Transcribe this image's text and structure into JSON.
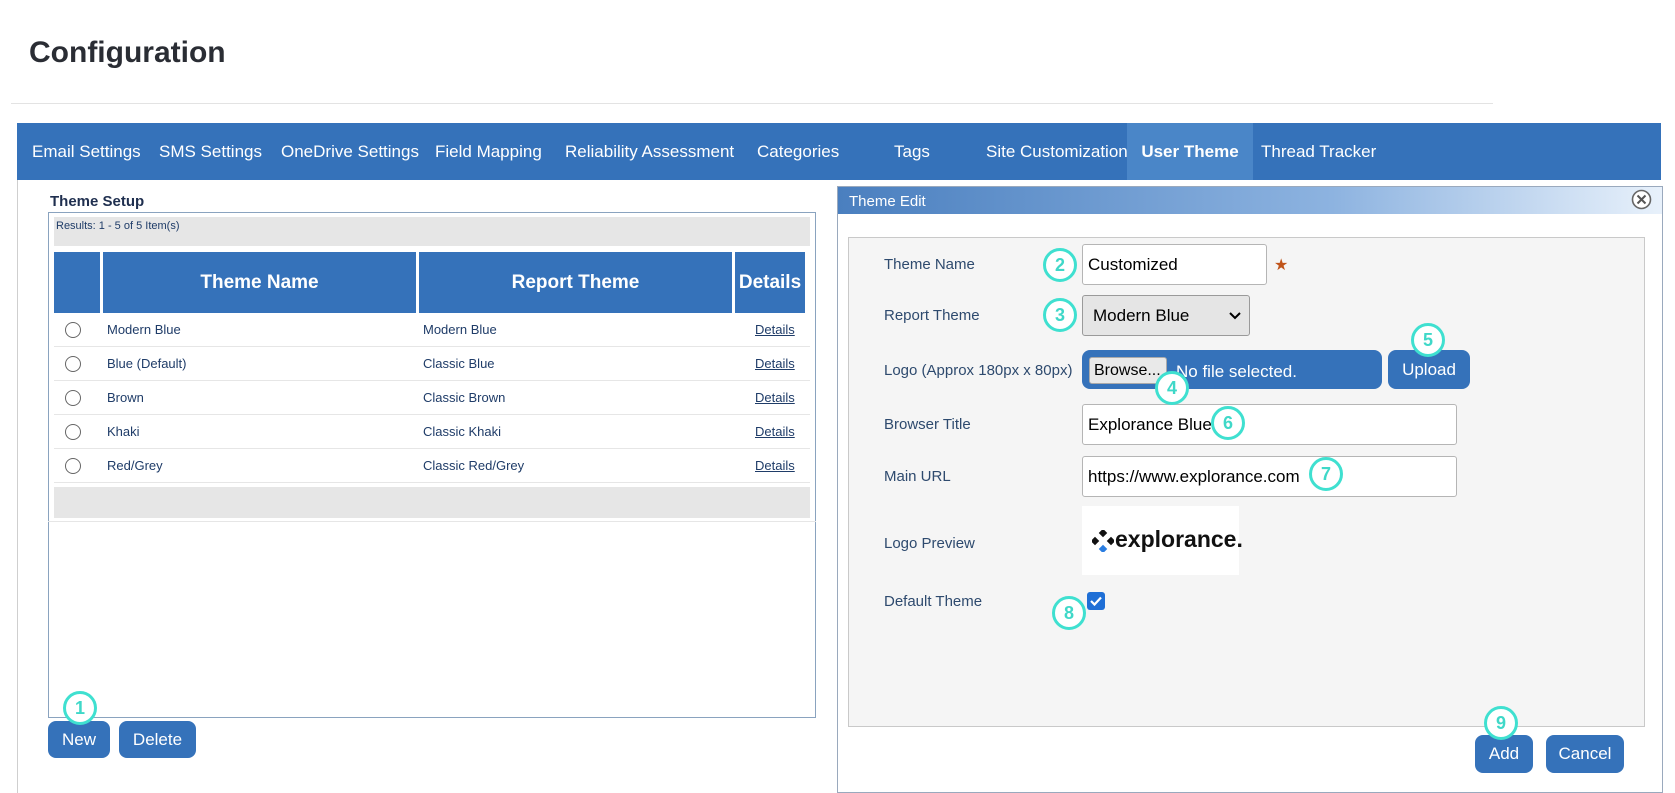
{
  "page": {
    "title": "Configuration"
  },
  "tabs": [
    {
      "label": "Email Settings",
      "active": false
    },
    {
      "label": "SMS Settings",
      "active": false
    },
    {
      "label": "OneDrive Settings",
      "active": false
    },
    {
      "label": "Field Mapping",
      "active": false
    },
    {
      "label": "Reliability Assessment",
      "active": false
    },
    {
      "label": "Categories",
      "active": false
    },
    {
      "label": "Tags",
      "active": false
    },
    {
      "label": "Site Customization",
      "active": false
    },
    {
      "label": "User Theme",
      "active": true
    },
    {
      "label": "Thread Tracker",
      "active": false
    }
  ],
  "theme_setup": {
    "title": "Theme Setup",
    "results": "Results: 1 - 5 of 5 Item(s)",
    "columns": [
      "Theme Name",
      "Report Theme",
      "Details"
    ],
    "rows": [
      {
        "name": "Modern Blue",
        "report": "Modern Blue",
        "details": "Details"
      },
      {
        "name": "Blue (Default)",
        "report": "Classic Blue",
        "details": "Details"
      },
      {
        "name": "Brown",
        "report": "Classic Brown",
        "details": "Details"
      },
      {
        "name": "Khaki",
        "report": "Classic Khaki",
        "details": "Details"
      },
      {
        "name": "Red/Grey",
        "report": "Classic Red/Grey",
        "details": "Details"
      }
    ],
    "new_label": "New",
    "delete_label": "Delete"
  },
  "theme_edit": {
    "title": "Theme Edit",
    "theme_name_label": "Theme Name",
    "theme_name_value": "Customized",
    "required_mark": "★",
    "report_theme_label": "Report Theme",
    "report_theme_value": "Modern Blue",
    "logo_label": "Logo (Approx 180px x 80px)",
    "browse_label": "Browse...",
    "no_file_text": "No file selected.",
    "upload_label": "Upload",
    "browser_title_label": "Browser Title",
    "browser_title_value": "Explorance Blue",
    "main_url_label": "Main URL",
    "main_url_value": "https://www.explorance.com",
    "logo_preview_label": "Logo Preview",
    "logo_text": "explorance.",
    "default_theme_label": "Default Theme",
    "default_theme_checked": true,
    "add_label": "Add",
    "cancel_label": "Cancel"
  },
  "markers": [
    "1",
    "2",
    "3",
    "4",
    "5",
    "6",
    "7",
    "8",
    "9"
  ],
  "colors": {
    "accent": "#3572ba",
    "marker": "#3fe0d0",
    "required": "#c0541a"
  }
}
